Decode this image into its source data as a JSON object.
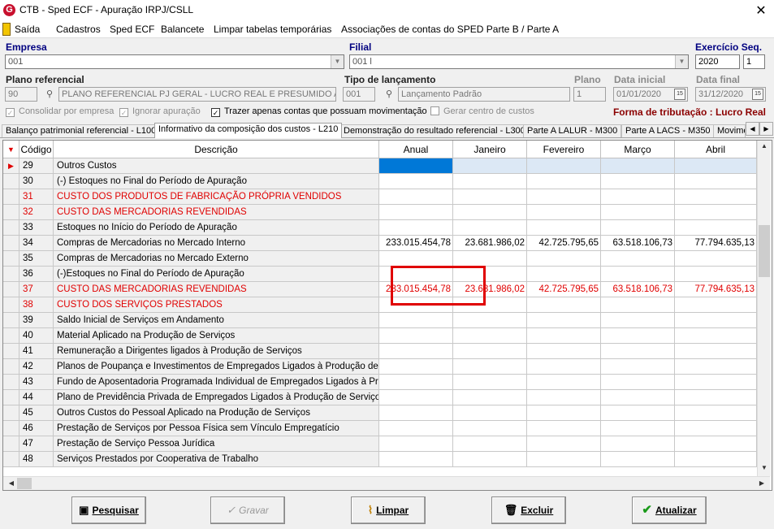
{
  "window": {
    "title": "CTB - Sped ECF - Apuração IRPJ/CSLL",
    "close": "✕"
  },
  "menu": [
    "Saída",
    "Cadastros",
    "Sped ECF",
    "Balancete",
    "Limpar tabelas temporárias",
    "Associações de contas do SPED Parte B / Parte A"
  ],
  "form": {
    "empresa_label": "Empresa",
    "empresa_value": "001",
    "filial_label": "Filial",
    "filial_value": "001 l",
    "exercicio_label": "Exercício Seq.",
    "exercicio_value": "2020",
    "seq_value": "1",
    "plano_ref_label": "Plano referencial",
    "plano_ref_code": "90",
    "plano_ref_desc": "PLANO REFERENCIAL PJ GERAL - LUCRO REAL E PRESUMIDO AN",
    "tipo_label": "Tipo de lançamento",
    "tipo_code": "001",
    "tipo_desc": "Lançamento Padrão",
    "plano_label": "Plano",
    "plano_value": "1",
    "data_inicial_label": "Data inicial",
    "data_inicial_value": "01/01/2020",
    "data_final_label": "Data final",
    "data_final_value": "31/12/2020",
    "consolidar": "Consolidar por empresa",
    "ignorar": "Ignorar apuração",
    "trazer": "Trazer apenas contas que possuam movimentação",
    "gerar": "Gerar centro de custos",
    "tributacao": "Forma de tributação : Lucro Real"
  },
  "tabs": [
    "Balanço patrimonial referencial - L100",
    "Informativo da composição dos custos - L210",
    "Demonstração do resultado referencial - L300",
    "Parte A LALUR - M300",
    "Parte A LACS - M350",
    "Movime"
  ],
  "grid": {
    "headers": {
      "codigo": "Código",
      "descricao": "Descrição",
      "anual": "Anual",
      "janeiro": "Janeiro",
      "fevereiro": "Fevereiro",
      "marco": "Março",
      "abril": "Abril"
    },
    "rows": [
      {
        "code": "29",
        "desc": "Outros Custos",
        "anual": "",
        "jan": "",
        "fev": "",
        "mar": "",
        "abr": ""
      },
      {
        "code": "30",
        "desc": "(-) Estoques no Final do Período de Apuração",
        "anual": "",
        "jan": "",
        "fev": "",
        "mar": "",
        "abr": ""
      },
      {
        "code": "31",
        "desc": "CUSTO DOS PRODUTOS DE FABRICAÇÃO PRÓPRIA VENDIDOS",
        "anual": "",
        "jan": "",
        "fev": "",
        "mar": "",
        "abr": ""
      },
      {
        "code": "32",
        "desc": "CUSTO DAS MERCADORIAS REVENDIDAS",
        "anual": "",
        "jan": "",
        "fev": "",
        "mar": "",
        "abr": ""
      },
      {
        "code": "33",
        "desc": "Estoques no Início do Período de Apuração",
        "anual": "",
        "jan": "",
        "fev": "",
        "mar": "",
        "abr": ""
      },
      {
        "code": "34",
        "desc": "Compras de Mercadorias no Mercado Interno",
        "anual": "233.015.454,78",
        "jan": "23.681.986,02",
        "fev": "42.725.795,65",
        "mar": "63.518.106,73",
        "abr": "77.794.635,13"
      },
      {
        "code": "35",
        "desc": "Compras de Mercadorias no Mercado Externo",
        "anual": "",
        "jan": "",
        "fev": "",
        "mar": "",
        "abr": ""
      },
      {
        "code": "36",
        "desc": "(-)Estoques no Final do Período de Apuração",
        "anual": "",
        "jan": "",
        "fev": "",
        "mar": "",
        "abr": ""
      },
      {
        "code": "37",
        "desc": "CUSTO DAS MERCADORIAS REVENDIDAS",
        "anual": "233.015.454,78",
        "jan": "23.681.986,02",
        "fev": "42.725.795,65",
        "mar": "63.518.106,73",
        "abr": "77.794.635,13"
      },
      {
        "code": "38",
        "desc": "CUSTO DOS SERVIÇOS PRESTADOS",
        "anual": "",
        "jan": "",
        "fev": "",
        "mar": "",
        "abr": ""
      },
      {
        "code": "39",
        "desc": "Saldo Inicial de Serviços em Andamento",
        "anual": "",
        "jan": "",
        "fev": "",
        "mar": "",
        "abr": ""
      },
      {
        "code": "40",
        "desc": "Material Aplicado na Produção de Serviços",
        "anual": "",
        "jan": "",
        "fev": "",
        "mar": "",
        "abr": ""
      },
      {
        "code": "41",
        "desc": "Remuneração a Dirigentes ligados à Produção de Serviços",
        "anual": "",
        "jan": "",
        "fev": "",
        "mar": "",
        "abr": ""
      },
      {
        "code": "42",
        "desc": "Planos de Poupança e Investimentos de Empregados Ligados à Produção de Ser...",
        "anual": "",
        "jan": "",
        "fev": "",
        "mar": "",
        "abr": ""
      },
      {
        "code": "43",
        "desc": "Fundo de Aposentadoria Programada Individual de Empregados Ligados à Produç...",
        "anual": "",
        "jan": "",
        "fev": "",
        "mar": "",
        "abr": ""
      },
      {
        "code": "44",
        "desc": "Plano de Previdência Privada de Empregados Ligados à Produção de Serviços",
        "anual": "",
        "jan": "",
        "fev": "",
        "mar": "",
        "abr": ""
      },
      {
        "code": "45",
        "desc": "Outros Custos do Pessoal Aplicado na Produção de Serviços",
        "anual": "",
        "jan": "",
        "fev": "",
        "mar": "",
        "abr": ""
      },
      {
        "code": "46",
        "desc": "Prestação de Serviços por Pessoa Física sem Vínculo Empregatício",
        "anual": "",
        "jan": "",
        "fev": "",
        "mar": "",
        "abr": ""
      },
      {
        "code": "47",
        "desc": "Prestação de Serviço Pessoa Jurídica",
        "anual": "",
        "jan": "",
        "fev": "",
        "mar": "",
        "abr": ""
      },
      {
        "code": "48",
        "desc": "Serviços Prestados por Cooperativa de Trabalho",
        "anual": "",
        "jan": "",
        "fev": "",
        "mar": "",
        "abr": ""
      }
    ],
    "red_codes": [
      "31",
      "32",
      "37",
      "38"
    ]
  },
  "buttons": {
    "pesquisar": "Pesquisar",
    "gravar": "Gravar",
    "limpar": "Limpar",
    "excluir": "Excluir",
    "atualizar": "Atualizar"
  }
}
